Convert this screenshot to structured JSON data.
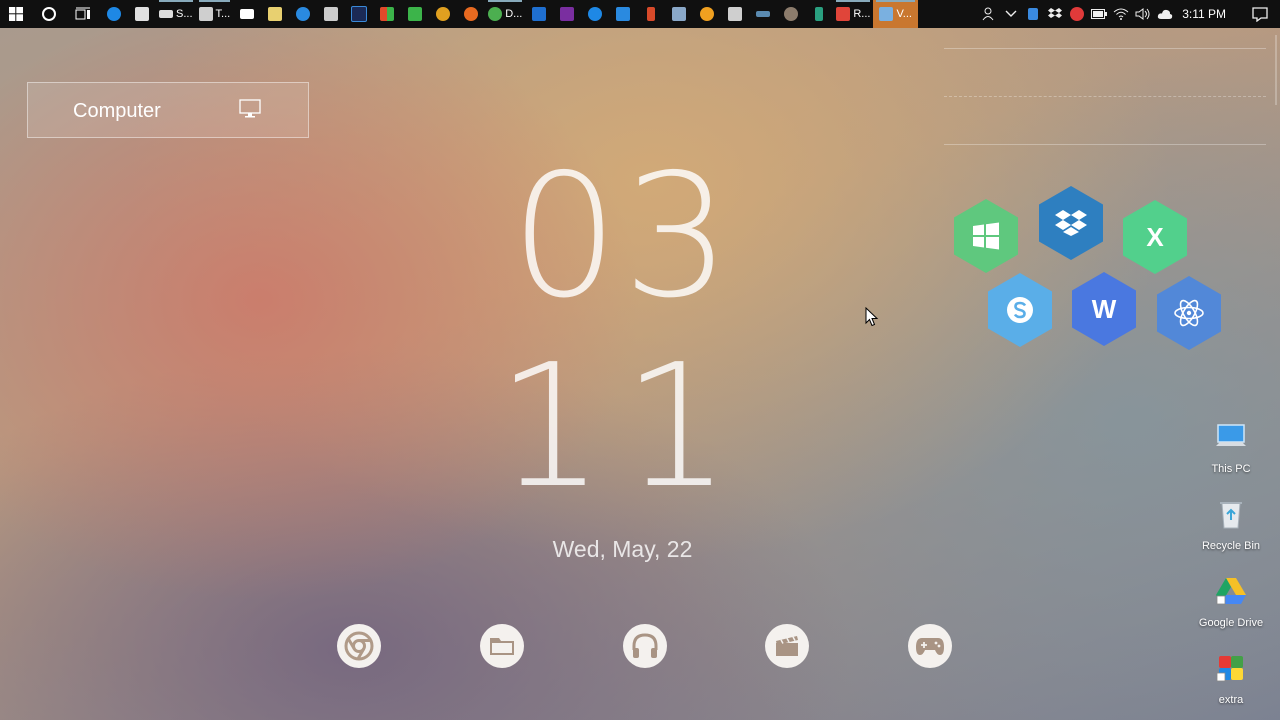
{
  "taskbar": {
    "apps": [
      {
        "name": "start-button",
        "icon": "windows-logo-icon"
      },
      {
        "name": "cortana-button",
        "icon": "circle-icon"
      },
      {
        "name": "task-view-button",
        "icon": "task-view-icon"
      },
      {
        "name": "edge",
        "icon": "edge-icon",
        "color": "#1e88e5"
      },
      {
        "name": "store",
        "icon": "store-icon",
        "color": "#e0e0e0"
      },
      {
        "name": "s-app",
        "icon": "drive-icon",
        "label": "S...",
        "color": "#dddddd"
      },
      {
        "name": "t-app",
        "icon": "remote-icon",
        "label": "T...",
        "color": "#cfcfcf"
      },
      {
        "name": "mail",
        "icon": "mail-icon",
        "color": "#ffffff"
      },
      {
        "name": "notes",
        "icon": "notes-icon",
        "color": "#e8d070"
      },
      {
        "name": "ie",
        "icon": "ie-icon",
        "color": "#2a8ae0"
      },
      {
        "name": "tools",
        "icon": "tools-icon",
        "color": "#cccccc"
      },
      {
        "name": "photoshop",
        "icon": "photoshop-icon",
        "color": "#1b2a55"
      },
      {
        "name": "tiles",
        "icon": "tiles-icon",
        "color": "#e04a2a"
      },
      {
        "name": "c-app",
        "icon": "c-icon",
        "color": "#3cb44a"
      },
      {
        "name": "chrome-canary",
        "icon": "chrome-icon",
        "color": "#e0a020"
      },
      {
        "name": "firefox",
        "icon": "firefox-icon",
        "color": "#e86a20"
      },
      {
        "name": "chrome",
        "icon": "chrome-icon",
        "label": "D...",
        "color": "#4caf50"
      },
      {
        "name": "dropbox-app",
        "icon": "dropbox-icon",
        "color": "#1f6fd0"
      },
      {
        "name": "purple-app",
        "icon": "film-icon",
        "color": "#7a2ea0"
      },
      {
        "name": "teamviewer",
        "icon": "teamviewer-icon",
        "color": "#1e88e5"
      },
      {
        "name": "settings-app",
        "icon": "gear-icon",
        "color": "#2a8ae0"
      },
      {
        "name": "red-app",
        "icon": "flame-icon",
        "color": "#d84a2a"
      },
      {
        "name": "image-app",
        "icon": "image-icon",
        "color": "#8aa8c8"
      },
      {
        "name": "orange-app",
        "icon": "orange-icon",
        "color": "#f0a020"
      },
      {
        "name": "network-app",
        "icon": "network-icon",
        "color": "#cfcfcf"
      },
      {
        "name": "code-app",
        "icon": "code-icon",
        "color": "#5a8ab0"
      },
      {
        "name": "gimp",
        "icon": "gimp-icon",
        "color": "#8c7c6c"
      },
      {
        "name": "green-app",
        "icon": "arrow-icon",
        "color": "#2aa080"
      },
      {
        "name": "r-app",
        "icon": "r-icon",
        "label": "R...",
        "color": "#e0453a"
      },
      {
        "name": "v-app",
        "icon": "v-icon",
        "label": "V...",
        "color": "#7ab0e0",
        "active": true
      }
    ],
    "tray": {
      "icons": [
        "people-icon",
        "chevron-up-icon",
        "tablet-icon",
        "dropbox-icon",
        "antivirus-icon",
        "battery-icon",
        "wifi-icon",
        "volume-icon",
        "cloud-icon"
      ],
      "time": "3:11 PM"
    }
  },
  "widget": {
    "computer_label": "Computer"
  },
  "clock": {
    "hour": "03",
    "minute": "11",
    "date": "Wed, May, 22"
  },
  "dock": [
    {
      "name": "dock-chrome",
      "icon": "chrome-icon"
    },
    {
      "name": "dock-files",
      "icon": "folder-icon"
    },
    {
      "name": "dock-music",
      "icon": "headphones-icon"
    },
    {
      "name": "dock-video",
      "icon": "clapperboard-icon"
    },
    {
      "name": "dock-games",
      "icon": "gamepad-icon"
    }
  ],
  "hex_tiles": [
    {
      "name": "hex-windows",
      "icon": "windows-icon",
      "color": "#5fc87e"
    },
    {
      "name": "hex-dropbox",
      "icon": "dropbox-icon",
      "color": "#2e7fc0"
    },
    {
      "name": "hex-excel",
      "icon": "excel-icon",
      "color": "#52d08c",
      "letter": "X"
    },
    {
      "name": "hex-skype",
      "icon": "skype-icon",
      "color": "#5aaee8"
    },
    {
      "name": "hex-word",
      "icon": "word-icon",
      "color": "#4a78e0",
      "letter": "W"
    },
    {
      "name": "hex-atom",
      "icon": "atom-icon",
      "color": "#5288d8"
    }
  ],
  "desktop_icons": [
    {
      "label": "This PC",
      "icon": "this-pc-icon"
    },
    {
      "label": "Recycle Bin",
      "icon": "recycle-bin-icon"
    },
    {
      "label": "Google Drive",
      "icon": "google-drive-icon"
    },
    {
      "label": "extra",
      "icon": "extra-icon"
    }
  ]
}
